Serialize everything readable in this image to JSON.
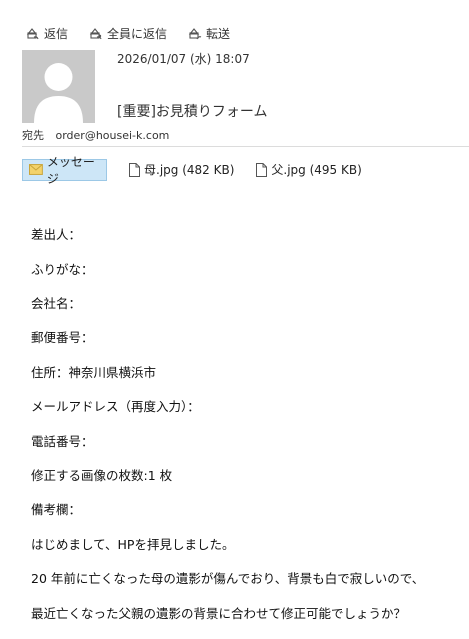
{
  "actions": {
    "reply": "返信",
    "reply_all": "全員に返信",
    "forward": "転送"
  },
  "header": {
    "date": "2026/01/07 (水) 18:07",
    "subject": "[重要]お見積りフォーム",
    "to_label": "宛先",
    "to_address": "order@housei-k.com"
  },
  "attachments": {
    "message_tab": "メッセージ",
    "files": [
      {
        "label": "母.jpg (482 KB)",
        "icon": "image-file-icon"
      },
      {
        "label": "父.jpg (495 KB)",
        "icon": "image-file-icon"
      }
    ]
  },
  "body_lines": [
    "差出人：",
    "ふりがな：",
    "会社名：",
    "郵便番号：",
    "住所：神奈川県横浜市",
    "メールアドレス（再度入力）：",
    "電話番号：",
    "修正する画像の枚数:1 枚",
    "備考欄：",
    "はじめまして、HPを拝見しました。",
    "20 年前に亡くなった母の遺影が傷んでおり、背景も白で寂しいので、",
    "最近亡くなった父親の遺影の背景に合わせて修正可能でしょうか？"
  ]
}
